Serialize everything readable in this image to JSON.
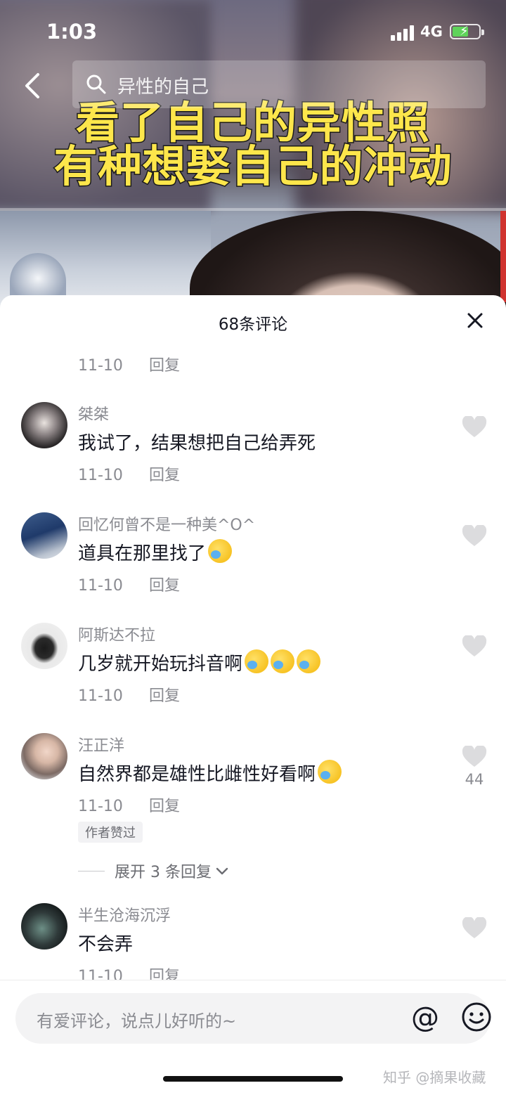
{
  "status_bar": {
    "time": "1:03",
    "network": "4G"
  },
  "search": {
    "query": "异性的自己"
  },
  "video": {
    "caption_line1": "看了自己的异性照",
    "caption_line2": "有种想娶自己的冲动"
  },
  "sheet": {
    "title": "68条评论"
  },
  "first_meta": {
    "date": "11-10",
    "reply": "回复"
  },
  "comments": [
    {
      "user": "桀桀",
      "text": "我试了，结果想把自己给弄死",
      "date": "11-10",
      "reply": "回复",
      "likes": ""
    },
    {
      "user": "回忆何曾不是一种美^O^",
      "text": "道具在那里找了",
      "date": "11-10",
      "reply": "回复",
      "likes": ""
    },
    {
      "user": "阿斯达不拉",
      "text": "几岁就开始玩抖音啊",
      "date": "11-10",
      "reply": "回复",
      "likes": ""
    },
    {
      "user": "汪正洋",
      "text": "自然界都是雄性比雌性好看啊",
      "date": "11-10",
      "reply": "回复",
      "likes": "44",
      "author_liked": "作者赞过",
      "expand": "展开 3 条回复"
    },
    {
      "user": "半生沧海沉浮",
      "text": "不会弄",
      "date": "11-10",
      "reply": "回复",
      "likes": ""
    }
  ],
  "input": {
    "placeholder": "有爱评论，说点儿好听的~"
  },
  "watermark": "知乎 @摘果收藏",
  "colors": {
    "caption_fill": "#fde64b",
    "text_primary": "#161823",
    "text_secondary": "#8a8b91"
  },
  "icons": [
    "back-icon",
    "search-icon",
    "close-icon",
    "heart-icon",
    "at-icon",
    "smile-icon"
  ]
}
